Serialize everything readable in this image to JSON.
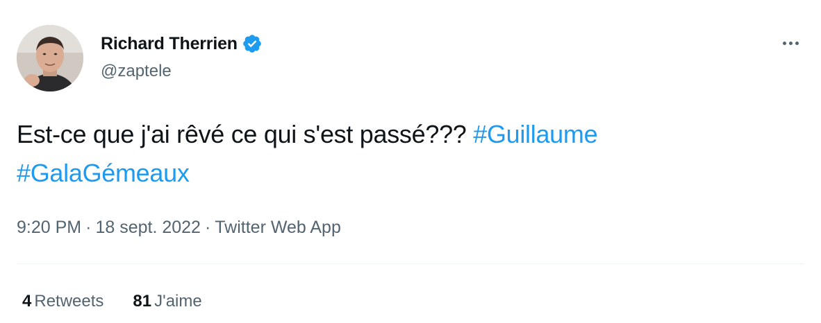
{
  "author": {
    "display_name": "Richard Therrien",
    "handle": "@zaptele",
    "verified": true
  },
  "tweet": {
    "text_plain": "Est-ce que j'ai rêvé ce qui s'est passé??? ",
    "hashtags": [
      "#Guillaume",
      "#GalaGémeaux"
    ]
  },
  "meta": {
    "time": "9:20 PM",
    "separator": "·",
    "date": "18 sept. 2022",
    "source": "Twitter Web App"
  },
  "stats": {
    "retweets_count": "4",
    "retweets_label": "Retweets",
    "likes_count": "81",
    "likes_label": "J'aime"
  },
  "colors": {
    "link": "#1d9bf0",
    "secondary_text": "#536471",
    "primary_text": "#0f1419",
    "divider": "#eff3f4"
  },
  "icons": {
    "verified": "verified-badge-icon",
    "more": "more-options-icon"
  }
}
